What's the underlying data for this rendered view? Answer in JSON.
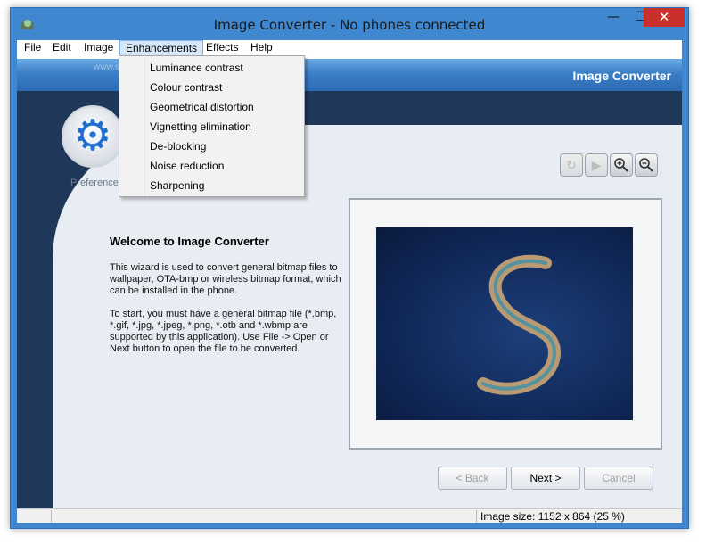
{
  "window": {
    "title": "Image Converter - No phones connected"
  },
  "titlebar": {
    "minimize": "—",
    "maximize": "☐",
    "close": "✕"
  },
  "menu": {
    "items": [
      "File",
      "Edit",
      "Image",
      "Enhancements",
      "Effects",
      "Help"
    ],
    "active": "Enhancements",
    "dropdown": [
      "Luminance contrast",
      "Colour contrast",
      "Geometrical distortion",
      "Vignetting elimination",
      "De-blocking",
      "Noise reduction",
      "Sharpening"
    ]
  },
  "header": {
    "title": "Image Converter",
    "watermark": "www.softpedia.com"
  },
  "sidebar": {
    "preferences_label": "Preferences"
  },
  "toolbar": {
    "icons": [
      "rotate-icon",
      "play-icon",
      "zoom-in-icon",
      "zoom-out-icon"
    ]
  },
  "welcome": {
    "title": "Welcome to Image Converter",
    "p1": "This wizard is used to convert general bitmap files to wallpaper, OTA-bmp or wireless bitmap format, which can be installed in the phone.",
    "p2": "To start, you must have a general bitmap file (*.bmp, *.gif, *.jpg, *.jpeg, *.png, *.otb and *.wbmp are supported by this application). Use File -> Open or Next button to open the file to be converted."
  },
  "buttons": {
    "back": "< Back",
    "next": "Next >",
    "cancel": "Cancel"
  },
  "status": {
    "image_size": "Image size: 1152 x 864 (25 %)"
  }
}
